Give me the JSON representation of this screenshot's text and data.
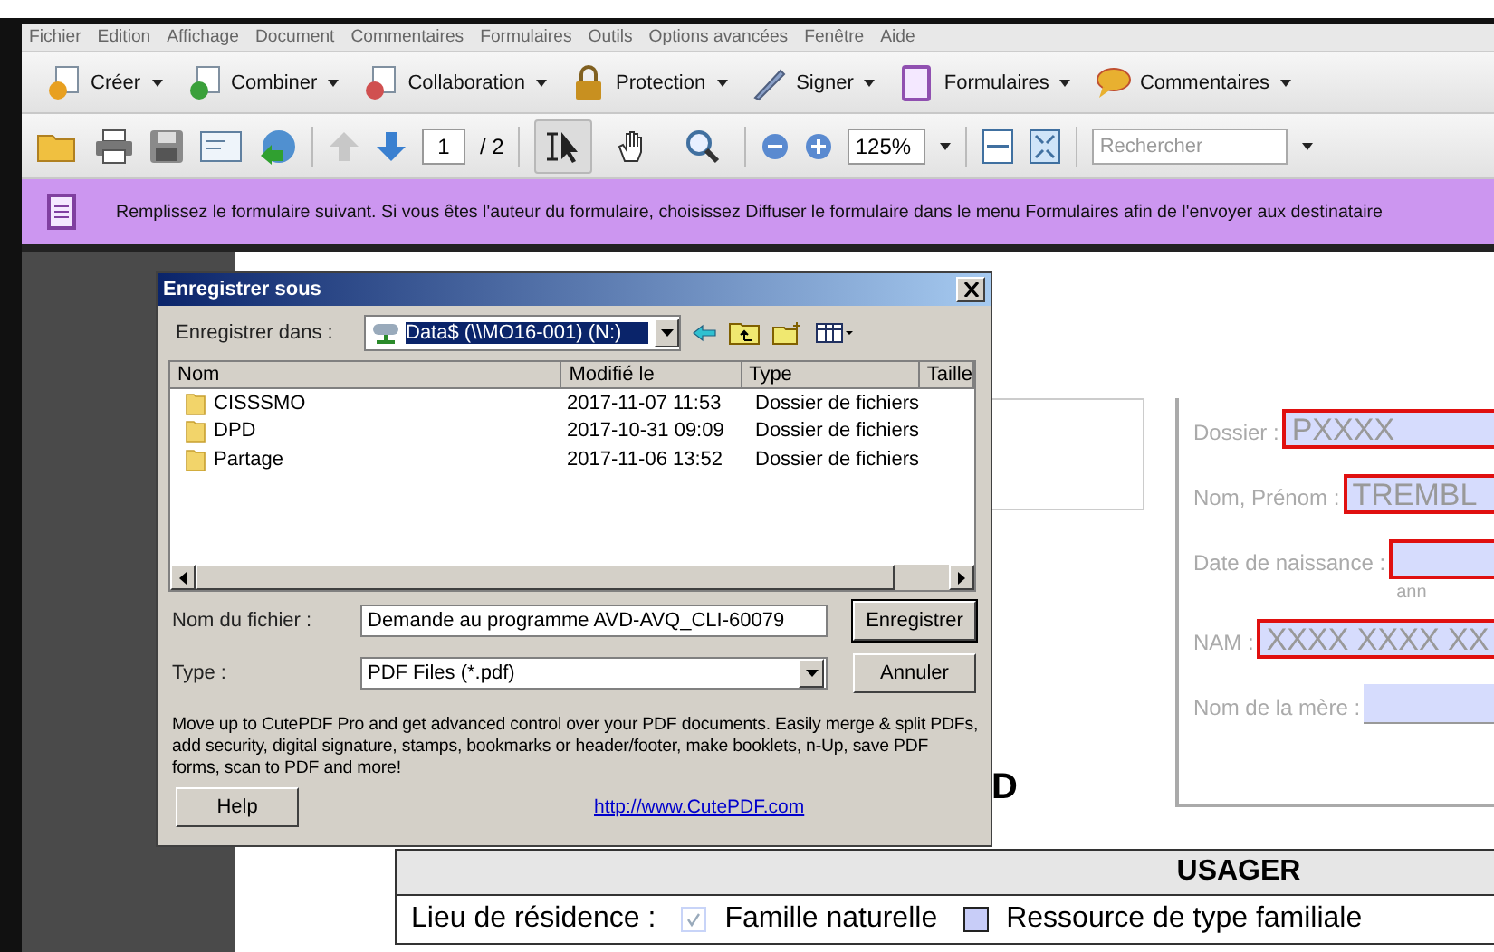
{
  "menu": [
    "Fichier",
    "Edition",
    "Affichage",
    "Document",
    "Commentaires",
    "Formulaires",
    "Outils",
    "Options avancées",
    "Fenêtre",
    "Aide"
  ],
  "tasks": [
    {
      "label": "Créer"
    },
    {
      "label": "Combiner"
    },
    {
      "label": "Collaboration"
    },
    {
      "label": "Protection"
    },
    {
      "label": "Signer"
    },
    {
      "label": "Formulaires"
    },
    {
      "label": "Commentaires"
    }
  ],
  "nav": {
    "previous_disabled": true,
    "next_disabled": false,
    "page": "1",
    "page_count": "/ 2"
  },
  "tools": [
    {
      "selected": true
    },
    {
      "selected": false
    },
    {
      "selected": false
    }
  ],
  "zoom": "125%",
  "search": {
    "placeholder": "Rechercher"
  },
  "notice": "Remplissez le formulaire suivant. Si vous êtes l'auteur du formulaire, choisissez Diffuser le formulaire dans le menu Formulaires afin de l'envoyer aux destinataire",
  "dialog": {
    "title": "Enregistrer sous",
    "save_in_label": "Enregistrer dans :",
    "location": "Data$ (\\\\MO16-001) (N:)",
    "columns": [
      "Nom",
      "Modifié le",
      "Type",
      "Taille"
    ],
    "rows": [
      {
        "name": "CISSSMO",
        "modified": "2017-11-07 11:53",
        "type": "Dossier de fichiers"
      },
      {
        "name": "DPD",
        "modified": "2017-10-31 09:09",
        "type": "Dossier de fichiers"
      },
      {
        "name": "Partage",
        "modified": "2017-11-06 13:52",
        "type": "Dossier de fichiers"
      }
    ],
    "filename_label": "Nom du fichier :",
    "filename": "Demande au programme AVD-AVQ_CLI-60079",
    "type_label": "Type :",
    "type": "PDF Files (*.pdf)",
    "save_button": "Enregistrer",
    "cancel_button": "Annuler",
    "promo": "Move up to CutePDF Pro and get advanced control over your PDF documents. Easily merge & split PDFs, add security, digital signature, stamps, bookmarks or header/footer, make booklets, n-Up, save PDF forms, scan to PDF and more!",
    "help_button": "Help",
    "link": "http://www.CutePDF.com"
  },
  "document": {
    "heading": "D",
    "fields": [
      {
        "label": "Dossier :",
        "value": "PXXXX",
        "required": true
      },
      {
        "label": "Nom, Prénom :",
        "value": "TREMBL",
        "required": true
      },
      {
        "label": "Date de naissance :",
        "hint": "ann",
        "required": true
      },
      {
        "label": "NAM :",
        "value": "XXXX XXXX XX",
        "required": true
      },
      {
        "label": "Nom de la mère :",
        "required": false
      }
    ],
    "section": {
      "title": "USAGER",
      "label": "Lieu de résidence :",
      "options": [
        {
          "label": "Famille naturelle",
          "checked": true
        },
        {
          "label": "Ressource de type familiale",
          "checked": false
        }
      ]
    }
  }
}
